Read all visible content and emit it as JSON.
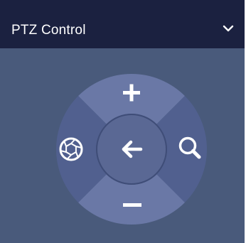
{
  "panel": {
    "title": "PTZ Control",
    "collapse_icon": "chevron-down-icon"
  },
  "ptz": {
    "top_icon": "plus-icon",
    "bottom_icon": "minus-icon",
    "left_icon": "aperture-icon",
    "right_icon": "magnifier-icon",
    "center_icon": "arrow-left-icon"
  },
  "colors": {
    "header_bg": "#1b2140",
    "panel_bg": "#495a7b",
    "segment_light": "#6a78a6",
    "segment_dark": "#51608f",
    "center_fill": "#5a6894",
    "icon": "#ffffff"
  }
}
